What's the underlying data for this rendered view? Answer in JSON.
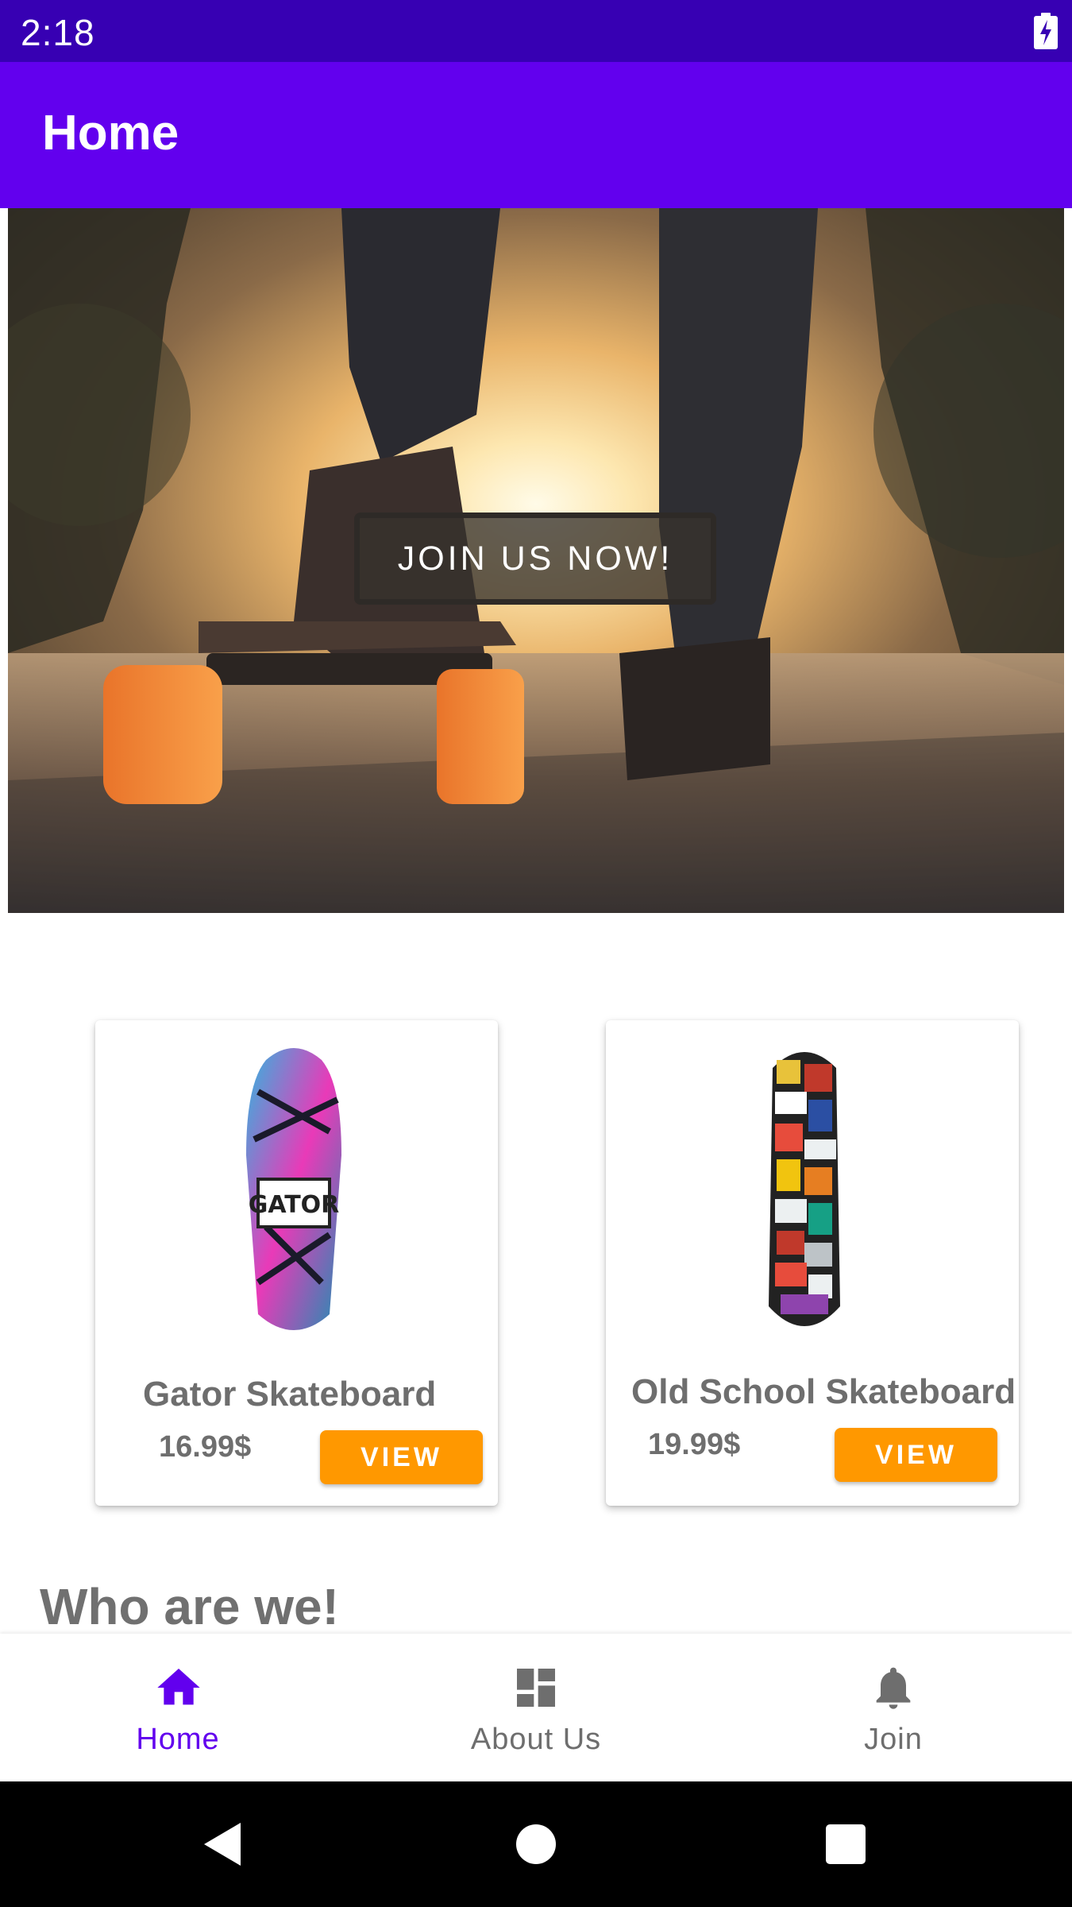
{
  "status_bar": {
    "time": "2:18",
    "battery_icon": "battery-charging-icon"
  },
  "app_bar": {
    "title": "Home"
  },
  "hero": {
    "image": "skateboarder-sunset-photo",
    "button_label": "JOIN US NOW!"
  },
  "products": [
    {
      "name": "Gator Skateboard",
      "price": "16.99$",
      "button_label": "VIEW",
      "board_text": "GATOR"
    },
    {
      "name": "Old School Skateboard",
      "price": "19.99$",
      "button_label": "VIEW"
    }
  ],
  "section": {
    "heading": "Who are we!"
  },
  "bottom_nav": {
    "items": [
      {
        "label": "Home",
        "icon": "home-icon",
        "active": true
      },
      {
        "label": "About Us",
        "icon": "dashboard-icon",
        "active": false
      },
      {
        "label": "Join",
        "icon": "bell-icon",
        "active": false
      }
    ]
  },
  "colors": {
    "status_bar": "#3700b3",
    "app_bar": "#6200ee",
    "accent_button": "#ff9800",
    "nav_active": "#6200ee",
    "nav_inactive": "#6e6e6e"
  }
}
